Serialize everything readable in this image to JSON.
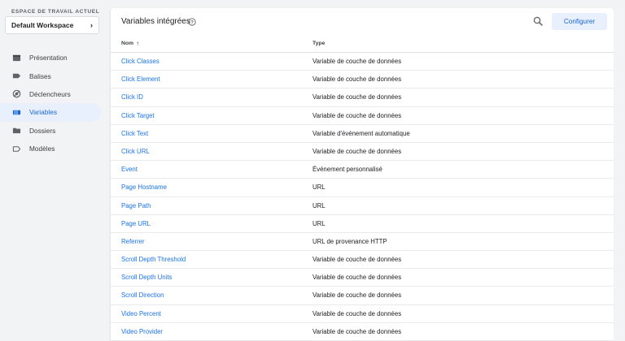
{
  "sidebar": {
    "workspace_label": "ESPACE DE TRAVAIL ACTUEL",
    "workspace_name": "Default Workspace",
    "items": [
      {
        "label": "Présentation",
        "icon": "overview-icon",
        "active": false
      },
      {
        "label": "Balises",
        "icon": "tag-icon",
        "active": false
      },
      {
        "label": "Déclencheurs",
        "icon": "trigger-icon",
        "active": false
      },
      {
        "label": "Variables",
        "icon": "variables-icon",
        "active": true
      },
      {
        "label": "Dossiers",
        "icon": "folder-icon",
        "active": false
      },
      {
        "label": "Modèles",
        "icon": "template-icon",
        "active": false
      }
    ]
  },
  "panel": {
    "title": "Variables intégrées",
    "configure_label": "Configurer",
    "columns": {
      "name": "Nom",
      "type": "Type"
    },
    "rows": [
      {
        "name": "Click Classes",
        "type": "Variable de couche de données"
      },
      {
        "name": "Click Element",
        "type": "Variable de couche de données"
      },
      {
        "name": "Click ID",
        "type": "Variable de couche de données"
      },
      {
        "name": "Click Target",
        "type": "Variable de couche de données"
      },
      {
        "name": "Click Text",
        "type": "Variable d'événement automatique"
      },
      {
        "name": "Click URL",
        "type": "Variable de couche de données"
      },
      {
        "name": "Event",
        "type": "Événement personnalisé"
      },
      {
        "name": "Page Hostname",
        "type": "URL"
      },
      {
        "name": "Page Path",
        "type": "URL"
      },
      {
        "name": "Page URL",
        "type": "URL"
      },
      {
        "name": "Referrer",
        "type": "URL de provenance HTTP"
      },
      {
        "name": "Scroll Depth Threshold",
        "type": "Variable de couche de données"
      },
      {
        "name": "Scroll Depth Units",
        "type": "Variable de couche de données"
      },
      {
        "name": "Scroll Direction",
        "type": "Variable de couche de données"
      },
      {
        "name": "Video Percent",
        "type": "Variable de couche de données"
      },
      {
        "name": "Video Provider",
        "type": "Variable de couche de données"
      }
    ]
  },
  "colors": {
    "accent": "#1a73e8",
    "active_bg": "#e8f0fe",
    "active_text": "#1967d2",
    "background": "#f1f3f4"
  }
}
